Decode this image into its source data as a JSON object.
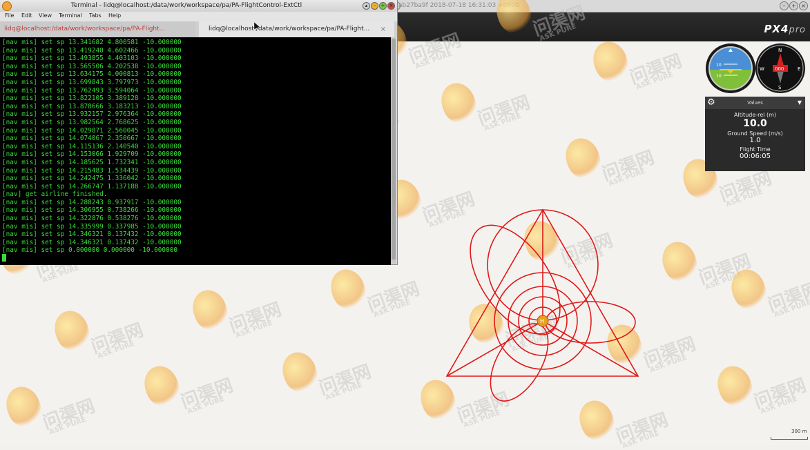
{
  "terminal": {
    "window_title": "Terminal - lidq@localhost:/data/work/workspace/pa/PA-FlightControl-ExtCtl",
    "menu": [
      "File",
      "Edit",
      "View",
      "Terminal",
      "Tabs",
      "Help"
    ],
    "tabs": [
      {
        "label": "lidq@localhost:/data/work/workspace/pa/PA-Flight...",
        "close": ""
      },
      {
        "label": "lidq@localhost:/data/work/workspace/pa/PA-Flight...",
        "close": "×"
      }
    ],
    "lines": [
      "[nav mis] set sp 13.341682 4.800581 -10.000000",
      "[nav mis] set sp 13.419240 4.602466 -10.000000",
      "[nav mis] set sp 13.493855 4.403103 -10.000000",
      "[nav mis] set sp 13.565506 4.202538 -10.000000",
      "[nav mis] set sp 13.634175 4.000813 -10.000000",
      "[nav mis] set sp 13.699843 3.797973 -10.000000",
      "[nav mis] set sp 13.762493 3.594064 -10.000000",
      "[nav mis] set sp 13.822105 3.389128 -10.000000",
      "[nav mis] set sp 13.878666 3.183213 -10.000000",
      "[nav mis] set sp 13.932157 2.976364 -10.000000",
      "[nav mis] set sp 13.982564 2.768625 -10.000000",
      "[nav mis] set sp 14.029871 2.560045 -10.000000",
      "[nav mis] set sp 14.074067 2.350667 -10.000000",
      "[nav mis] set sp 14.115136 2.140540 -10.000000",
      "[nav mis] set sp 14.153066 1.929709 -10.000000",
      "[nav mis] set sp 14.185625 1.732341 -10.000000",
      "[nav mis] set sp 14.215483 1.534439 -10.000000",
      "[nav mis] set sp 14.242475 1.336042 -10.000000",
      "[nav mis] set sp 14.266747 1.137188 -10.000000",
      "[nav] get airline finished.",
      "[nav mis] set sp 14.288243 0.937917 -10.000000",
      "[nav mis] set sp 14.306955 0.738266 -10.000000",
      "[nav mis] set sp 14.322876 0.538276 -10.000000",
      "[nav mis] set sp 14.335999 0.337985 -10.000000",
      "[nav mis] set sp 14.346321 0.137432 -10.000000",
      "[nav mis] set sp 14.346321 0.137432 -10.000000",
      "[nav mis] set sp 0.000000 0.000000 -10.000000"
    ]
  },
  "gcs": {
    "title": "ab27ba9f 2018-07-18 16:31:03 +0800",
    "logo_main": "PX4",
    "logo_suffix": "pro",
    "values_panel": {
      "header": "Values",
      "altitude_label": "Altitude-rel (m)",
      "altitude_value": "10.0",
      "ground_speed_label": "Ground Speed (m/s)",
      "ground_speed_value": "1.0",
      "flight_time_label": "Flight Time",
      "flight_time_value": "00:06:05"
    },
    "compass": {
      "north": "N",
      "south": "S",
      "east": "E",
      "west": "W",
      "heading": "000"
    },
    "attitude": {
      "pitch_label_top": "10",
      "pitch_label_bottom": "10"
    },
    "scale_label": "300 m",
    "vehicle_marker": "H",
    "trajectory_color": "#e01818"
  },
  "watermark": {
    "text_cn": "问渠网",
    "text_en": "ASK PURE"
  }
}
